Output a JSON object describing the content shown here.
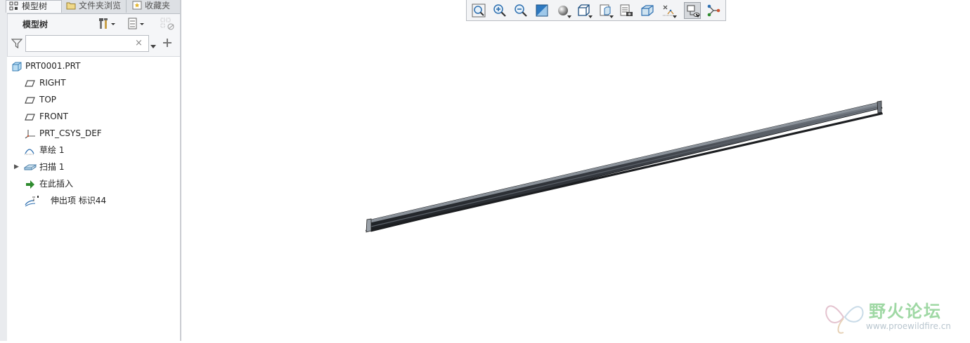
{
  "panel": {
    "tabs": [
      {
        "label": "模型树"
      },
      {
        "label": "文件夹浏览"
      },
      {
        "label": "收藏夹"
      }
    ],
    "tree_title": "模型树",
    "search": {
      "value": "",
      "placeholder": ""
    },
    "search_clear": "×"
  },
  "tree": {
    "items": [
      {
        "label": "PRT0001.PRT",
        "icon": "part-icon"
      },
      {
        "label": "RIGHT",
        "icon": "datum-plane-icon"
      },
      {
        "label": "TOP",
        "icon": "datum-plane-icon"
      },
      {
        "label": "FRONT",
        "icon": "datum-plane-icon"
      },
      {
        "label": "PRT_CSYS_DEF",
        "icon": "csys-icon"
      },
      {
        "label": "草绘 1",
        "icon": "sketch-icon"
      },
      {
        "label": "扫描 1",
        "icon": "sweep-icon",
        "expandable": true
      },
      {
        "label": "在此插入",
        "icon": "insert-here-icon"
      },
      {
        "label": "伸出项 标识44",
        "icon": "protrusion-icon"
      }
    ]
  },
  "toolbar": {
    "buttons": [
      {
        "name": "refit",
        "icon": "zoom-fit-icon"
      },
      {
        "name": "zoom-in",
        "icon": "zoom-in-icon"
      },
      {
        "name": "zoom-out",
        "icon": "zoom-out-icon"
      },
      {
        "name": "repaint",
        "icon": "repaint-icon"
      },
      {
        "name": "display-style",
        "icon": "display-style-icon"
      },
      {
        "name": "saved-orientations",
        "icon": "view-orient-icon"
      },
      {
        "name": "view-manager",
        "icon": "view-manager-icon"
      },
      {
        "name": "layers",
        "icon": "layers-icon"
      },
      {
        "name": "perspective",
        "icon": "perspective-icon"
      },
      {
        "name": "datum-display",
        "icon": "datum-display-icon"
      },
      {
        "name": "spin-center",
        "icon": "spin-center-icon"
      },
      {
        "name": "annotation-display",
        "icon": "annotation-icon",
        "active": true
      },
      {
        "name": "network",
        "icon": "network-icon"
      }
    ]
  },
  "watermark": {
    "title": "野火论坛",
    "url": "www.proewildfire.cn"
  },
  "colors": {
    "panel_bg": "#f5f6f8",
    "model_dark": "#3b3f46",
    "model_light": "#5e646d",
    "watermark_green": "#9fd8a4"
  }
}
